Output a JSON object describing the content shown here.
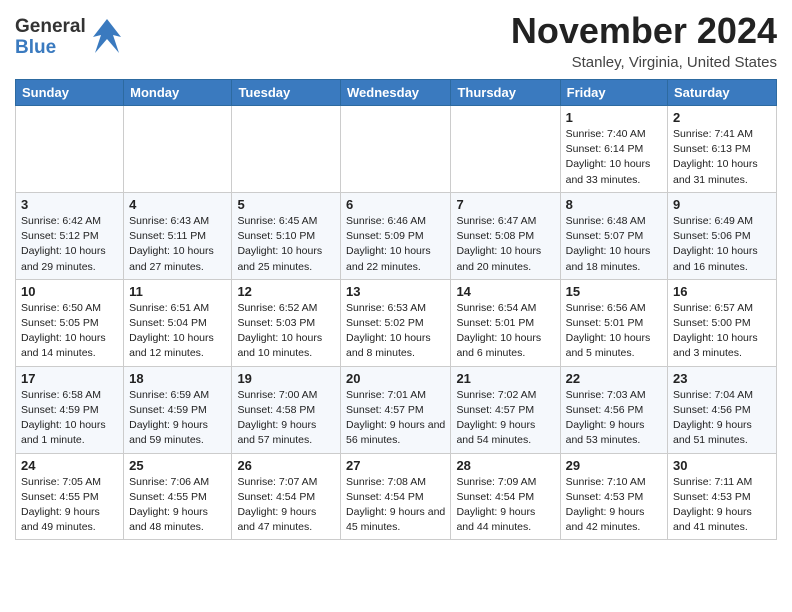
{
  "header": {
    "logo_general": "General",
    "logo_blue": "Blue",
    "month_title": "November 2024",
    "location": "Stanley, Virginia, United States"
  },
  "weekdays": [
    "Sunday",
    "Monday",
    "Tuesday",
    "Wednesday",
    "Thursday",
    "Friday",
    "Saturday"
  ],
  "weeks": [
    [
      {
        "day": "",
        "info": ""
      },
      {
        "day": "",
        "info": ""
      },
      {
        "day": "",
        "info": ""
      },
      {
        "day": "",
        "info": ""
      },
      {
        "day": "",
        "info": ""
      },
      {
        "day": "1",
        "info": "Sunrise: 7:40 AM\nSunset: 6:14 PM\nDaylight: 10 hours and 33 minutes."
      },
      {
        "day": "2",
        "info": "Sunrise: 7:41 AM\nSunset: 6:13 PM\nDaylight: 10 hours and 31 minutes."
      }
    ],
    [
      {
        "day": "3",
        "info": "Sunrise: 6:42 AM\nSunset: 5:12 PM\nDaylight: 10 hours and 29 minutes."
      },
      {
        "day": "4",
        "info": "Sunrise: 6:43 AM\nSunset: 5:11 PM\nDaylight: 10 hours and 27 minutes."
      },
      {
        "day": "5",
        "info": "Sunrise: 6:45 AM\nSunset: 5:10 PM\nDaylight: 10 hours and 25 minutes."
      },
      {
        "day": "6",
        "info": "Sunrise: 6:46 AM\nSunset: 5:09 PM\nDaylight: 10 hours and 22 minutes."
      },
      {
        "day": "7",
        "info": "Sunrise: 6:47 AM\nSunset: 5:08 PM\nDaylight: 10 hours and 20 minutes."
      },
      {
        "day": "8",
        "info": "Sunrise: 6:48 AM\nSunset: 5:07 PM\nDaylight: 10 hours and 18 minutes."
      },
      {
        "day": "9",
        "info": "Sunrise: 6:49 AM\nSunset: 5:06 PM\nDaylight: 10 hours and 16 minutes."
      }
    ],
    [
      {
        "day": "10",
        "info": "Sunrise: 6:50 AM\nSunset: 5:05 PM\nDaylight: 10 hours and 14 minutes."
      },
      {
        "day": "11",
        "info": "Sunrise: 6:51 AM\nSunset: 5:04 PM\nDaylight: 10 hours and 12 minutes."
      },
      {
        "day": "12",
        "info": "Sunrise: 6:52 AM\nSunset: 5:03 PM\nDaylight: 10 hours and 10 minutes."
      },
      {
        "day": "13",
        "info": "Sunrise: 6:53 AM\nSunset: 5:02 PM\nDaylight: 10 hours and 8 minutes."
      },
      {
        "day": "14",
        "info": "Sunrise: 6:54 AM\nSunset: 5:01 PM\nDaylight: 10 hours and 6 minutes."
      },
      {
        "day": "15",
        "info": "Sunrise: 6:56 AM\nSunset: 5:01 PM\nDaylight: 10 hours and 5 minutes."
      },
      {
        "day": "16",
        "info": "Sunrise: 6:57 AM\nSunset: 5:00 PM\nDaylight: 10 hours and 3 minutes."
      }
    ],
    [
      {
        "day": "17",
        "info": "Sunrise: 6:58 AM\nSunset: 4:59 PM\nDaylight: 10 hours and 1 minute."
      },
      {
        "day": "18",
        "info": "Sunrise: 6:59 AM\nSunset: 4:59 PM\nDaylight: 9 hours and 59 minutes."
      },
      {
        "day": "19",
        "info": "Sunrise: 7:00 AM\nSunset: 4:58 PM\nDaylight: 9 hours and 57 minutes."
      },
      {
        "day": "20",
        "info": "Sunrise: 7:01 AM\nSunset: 4:57 PM\nDaylight: 9 hours and 56 minutes."
      },
      {
        "day": "21",
        "info": "Sunrise: 7:02 AM\nSunset: 4:57 PM\nDaylight: 9 hours and 54 minutes."
      },
      {
        "day": "22",
        "info": "Sunrise: 7:03 AM\nSunset: 4:56 PM\nDaylight: 9 hours and 53 minutes."
      },
      {
        "day": "23",
        "info": "Sunrise: 7:04 AM\nSunset: 4:56 PM\nDaylight: 9 hours and 51 minutes."
      }
    ],
    [
      {
        "day": "24",
        "info": "Sunrise: 7:05 AM\nSunset: 4:55 PM\nDaylight: 9 hours and 49 minutes."
      },
      {
        "day": "25",
        "info": "Sunrise: 7:06 AM\nSunset: 4:55 PM\nDaylight: 9 hours and 48 minutes."
      },
      {
        "day": "26",
        "info": "Sunrise: 7:07 AM\nSunset: 4:54 PM\nDaylight: 9 hours and 47 minutes."
      },
      {
        "day": "27",
        "info": "Sunrise: 7:08 AM\nSunset: 4:54 PM\nDaylight: 9 hours and 45 minutes."
      },
      {
        "day": "28",
        "info": "Sunrise: 7:09 AM\nSunset: 4:54 PM\nDaylight: 9 hours and 44 minutes."
      },
      {
        "day": "29",
        "info": "Sunrise: 7:10 AM\nSunset: 4:53 PM\nDaylight: 9 hours and 42 minutes."
      },
      {
        "day": "30",
        "info": "Sunrise: 7:11 AM\nSunset: 4:53 PM\nDaylight: 9 hours and 41 minutes."
      }
    ]
  ]
}
